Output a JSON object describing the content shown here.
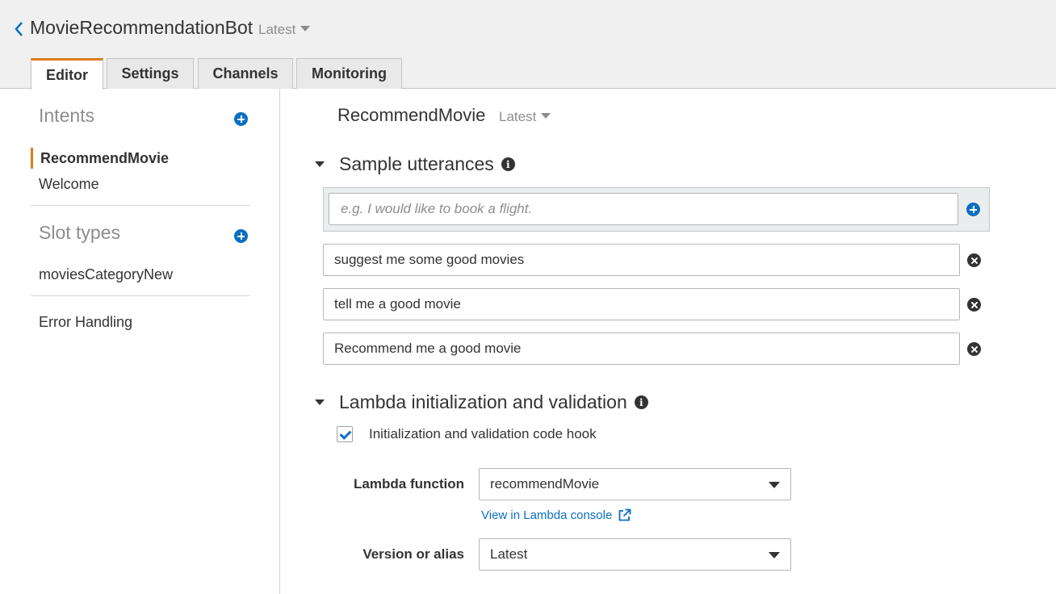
{
  "header": {
    "bot_name": "MovieRecommendationBot",
    "version": "Latest",
    "tabs": [
      {
        "label": "Editor",
        "active": true
      },
      {
        "label": "Settings"
      },
      {
        "label": "Channels"
      },
      {
        "label": "Monitoring"
      }
    ]
  },
  "sidebar": {
    "intents_title": "Intents",
    "intents": [
      "RecommendMovie",
      "Welcome"
    ],
    "slot_types_title": "Slot types",
    "slot_types": [
      "moviesCategoryNew"
    ],
    "error_handling": "Error Handling"
  },
  "main": {
    "intent_name": "RecommendMovie",
    "intent_version": "Latest",
    "utterances_title": "Sample utterances",
    "utterance_placeholder": "e.g. I would like to book a flight.",
    "utterances": [
      "suggest me some good movies",
      "tell me a good movie",
      "Recommend me a good movie"
    ],
    "lambda_title": "Lambda initialization and validation",
    "code_hook_label": "Initialization and validation code hook",
    "code_hook_checked": true,
    "lambda_function_label": "Lambda function",
    "lambda_function_value": "recommendMovie",
    "lambda_console_link": "View in Lambda console",
    "version_alias_label": "Version or alias",
    "version_alias_value": "Latest"
  },
  "colors": {
    "accent": "#e07b1a",
    "link": "#0a6fc2",
    "header_bg": "#f0f0f0"
  }
}
